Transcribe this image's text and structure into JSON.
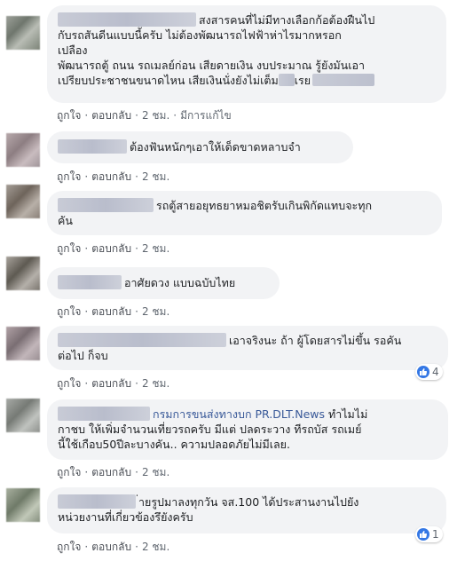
{
  "actions": {
    "like": "ถูกใจ",
    "reply": "ตอบกลับ",
    "edited": "มีการแก้ไข",
    "sep": "·"
  },
  "comments": [
    {
      "lines": [
        "สงสารคนที่ไม่มีทางเลือกก้อต้องฝืนไป",
        "กับรถสันดีนแบบนี้ครับ ไม่ต้องพัฒนารถไฟฟ้าห่าไรมากหรอก",
        "เปลือง",
        "พัฒนารถตู้ ถนน รถเมลย์ก่อน เสียดายเงิน งบประมาณ รู้ยังมันเอา",
        "เปรียบประชาชนขนาดไหน เสียเงินนั่งยังไม่เต็ม",
        "เรย"
      ],
      "time": "2 ชม."
    },
    {
      "text": "ต้องฟันหนักๆเอาให้เด็ดขาดหลาบจำ",
      "time": "2 ชม."
    },
    {
      "lines": [
        "รถตู้สายอยุทธยาหมอชิตรับเกินพิกัดแทบจะทุก",
        "คัน"
      ],
      "time": "2 ชม."
    },
    {
      "text": "อาศัยดวง แบบฉบับไทย",
      "time": "2 ชม."
    },
    {
      "lines": [
        "เอาจริงนะ ถ้า ผู้โดยสารไม่ขึ้น รอคัน",
        "ต่อไป ก็จบ"
      ],
      "time": "2 ชม.",
      "reactions": "4"
    },
    {
      "mention": "กรมการขนส่งทางบก PR.DLT.News",
      "lines": [
        "ทำไมไม่",
        "กาชบ ให้เพิ่มจำนวนเที่ยวรถครับ มีแต่ ปลดระวาง ทีรถบัส รถเมย์",
        "นี้ใช้เกือบ50ปีละบางคัน.. ความปลอดภัยไม่มีเลย."
      ],
      "time": "2 ชม."
    },
    {
      "lines": [
        "่ายรูปมาลงทุกวัน จส.100 ได้ประสานงานไปยัง",
        "หน่วยงานที่เกี่ยวข้องรึยังครับ"
      ],
      "time": "2 ชม.",
      "reactions": "1"
    }
  ]
}
